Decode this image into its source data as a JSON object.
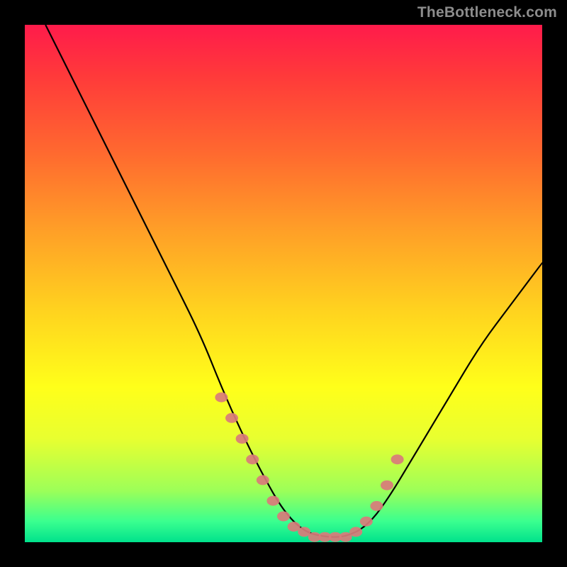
{
  "watermark": "TheBottleneck.com",
  "chart_data": {
    "type": "line",
    "title": "",
    "xlabel": "",
    "ylabel": "",
    "xlim": [
      0,
      100
    ],
    "ylim": [
      0,
      100
    ],
    "curve": {
      "name": "bottleneck-curve",
      "description": "V-shaped curve descending from top-left, reaching flat minimum near bottom center, then rising toward upper-right",
      "x": [
        4,
        10,
        16,
        22,
        28,
        34,
        38,
        42,
        46,
        50,
        54,
        58,
        62,
        66,
        70,
        76,
        82,
        88,
        94,
        100
      ],
      "y": [
        100,
        88,
        76,
        64,
        52,
        40,
        30,
        21,
        13,
        6,
        2,
        1,
        1,
        3,
        8,
        18,
        28,
        38,
        46,
        54
      ]
    },
    "markers": {
      "name": "valley-markers",
      "color": "#d97b7b",
      "x": [
        38,
        40,
        42,
        44,
        46,
        48,
        50,
        52,
        54,
        56,
        58,
        60,
        62,
        64,
        66,
        68,
        70,
        72
      ],
      "y": [
        28,
        24,
        20,
        16,
        12,
        8,
        5,
        3,
        2,
        1,
        1,
        1,
        1,
        2,
        4,
        7,
        11,
        16
      ]
    }
  }
}
